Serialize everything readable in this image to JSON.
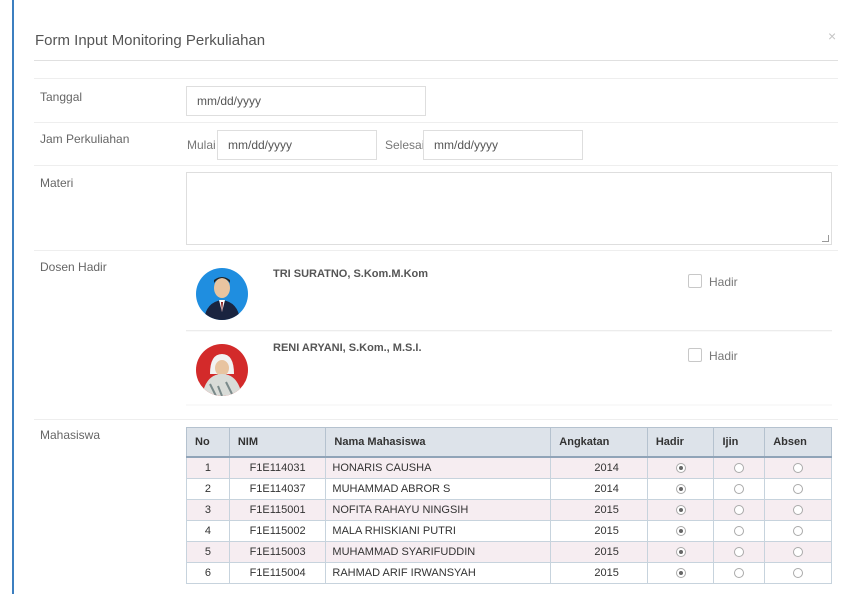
{
  "modal": {
    "title": "Form Input Monitoring Perkuliahan",
    "close": "×"
  },
  "tanggal": {
    "label": "Tanggal",
    "value": "mm/dd/yyyy"
  },
  "jam": {
    "label": "Jam Perkuliahan",
    "mulai_label": "Mulai",
    "mulai_value": "mm/dd/yyyy",
    "selesai_label": "Selesai",
    "selesai_value": "mm/dd/yyyy"
  },
  "materi": {
    "label": "Materi",
    "value": ""
  },
  "dosen": {
    "label": "Dosen Hadir",
    "items": [
      {
        "name": "TRI SURATNO, S.Kom.M.Kom",
        "hadir_label": "Hadir",
        "checked": false
      },
      {
        "name": "RENI ARYANI, S.Kom., M.S.I.",
        "hadir_label": "Hadir",
        "checked": false
      }
    ]
  },
  "mahasiswa": {
    "label": "Mahasiswa",
    "headers": [
      "No",
      "NIM",
      "Nama Mahasiswa",
      "Angkatan",
      "Hadir",
      "Ijin",
      "Absen"
    ],
    "rows": [
      {
        "no": "1",
        "nim": "F1E114031",
        "nama": "HONARIS CAUSHA",
        "angkatan": "2014",
        "status": "hadir"
      },
      {
        "no": "2",
        "nim": "F1E114037",
        "nama": "MUHAMMAD ABROR S",
        "angkatan": "2014",
        "status": "hadir"
      },
      {
        "no": "3",
        "nim": "F1E115001",
        "nama": "NOFITA RAHAYU NINGSIH",
        "angkatan": "2015",
        "status": "hadir"
      },
      {
        "no": "4",
        "nim": "F1E115002",
        "nama": "MALA RHISKIANI PUTRI",
        "angkatan": "2015",
        "status": "hadir"
      },
      {
        "no": "5",
        "nim": "F1E115003",
        "nama": "MUHAMMAD SYARIFUDDIN",
        "angkatan": "2015",
        "status": "hadir"
      },
      {
        "no": "6",
        "nim": "F1E115004",
        "nama": "RAHMAD ARIF IRWANSYAH",
        "angkatan": "2015",
        "status": "hadir"
      }
    ]
  },
  "colors": {
    "accent": "#3c7fc0",
    "row_odd": "#f6edf1",
    "header_bg": "#dde3ea"
  }
}
